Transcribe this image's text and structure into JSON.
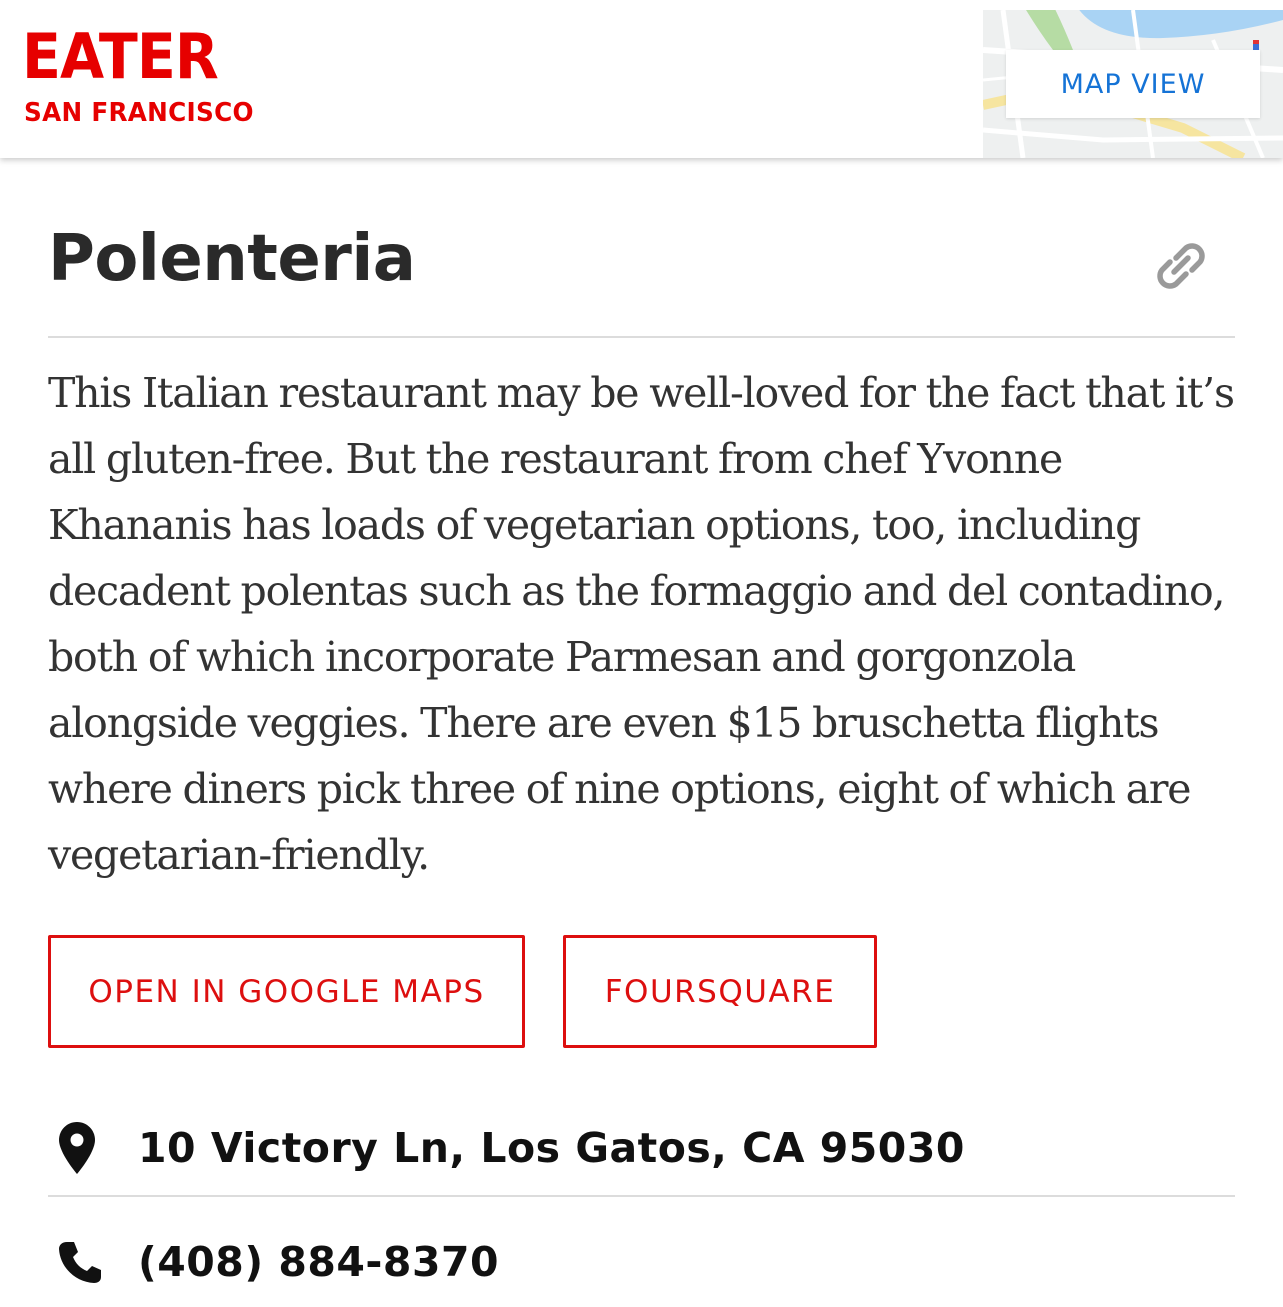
{
  "header": {
    "logo_main": "EATER",
    "logo_city": "SAN FRANCISCO",
    "map_button_label": "MAP VIEW"
  },
  "venue": {
    "name": "Polenteria",
    "description": "This Italian restaurant may be well-loved for the fact that it’s all gluten-free. But the restaurant from chef Yvonne Khananis has loads of vegetarian options, too, including decadent polentas such as the formaggio and del contadino, both of which incorporate Parmesan and gorgonzola alongside veggies. There are even $15 bruschetta flights where diners pick three of nine options, eight of which are vegetarian-friendly.",
    "address": "10 Victory Ln, Los Gatos, CA 95030",
    "phone": "(408) 884-8370"
  },
  "actions": {
    "google_maps_label": "OPEN IN GOOGLE MAPS",
    "foursquare_label": "FOURSQUARE"
  },
  "icons": {
    "link": "link-icon",
    "location": "map-pin-icon",
    "phone": "phone-icon"
  },
  "colors": {
    "brand_red": "#e60000",
    "button_red": "#dd0f0f",
    "map_button_blue": "#1573d6",
    "title_text": "#2a2a2a",
    "body_text": "#333333"
  }
}
